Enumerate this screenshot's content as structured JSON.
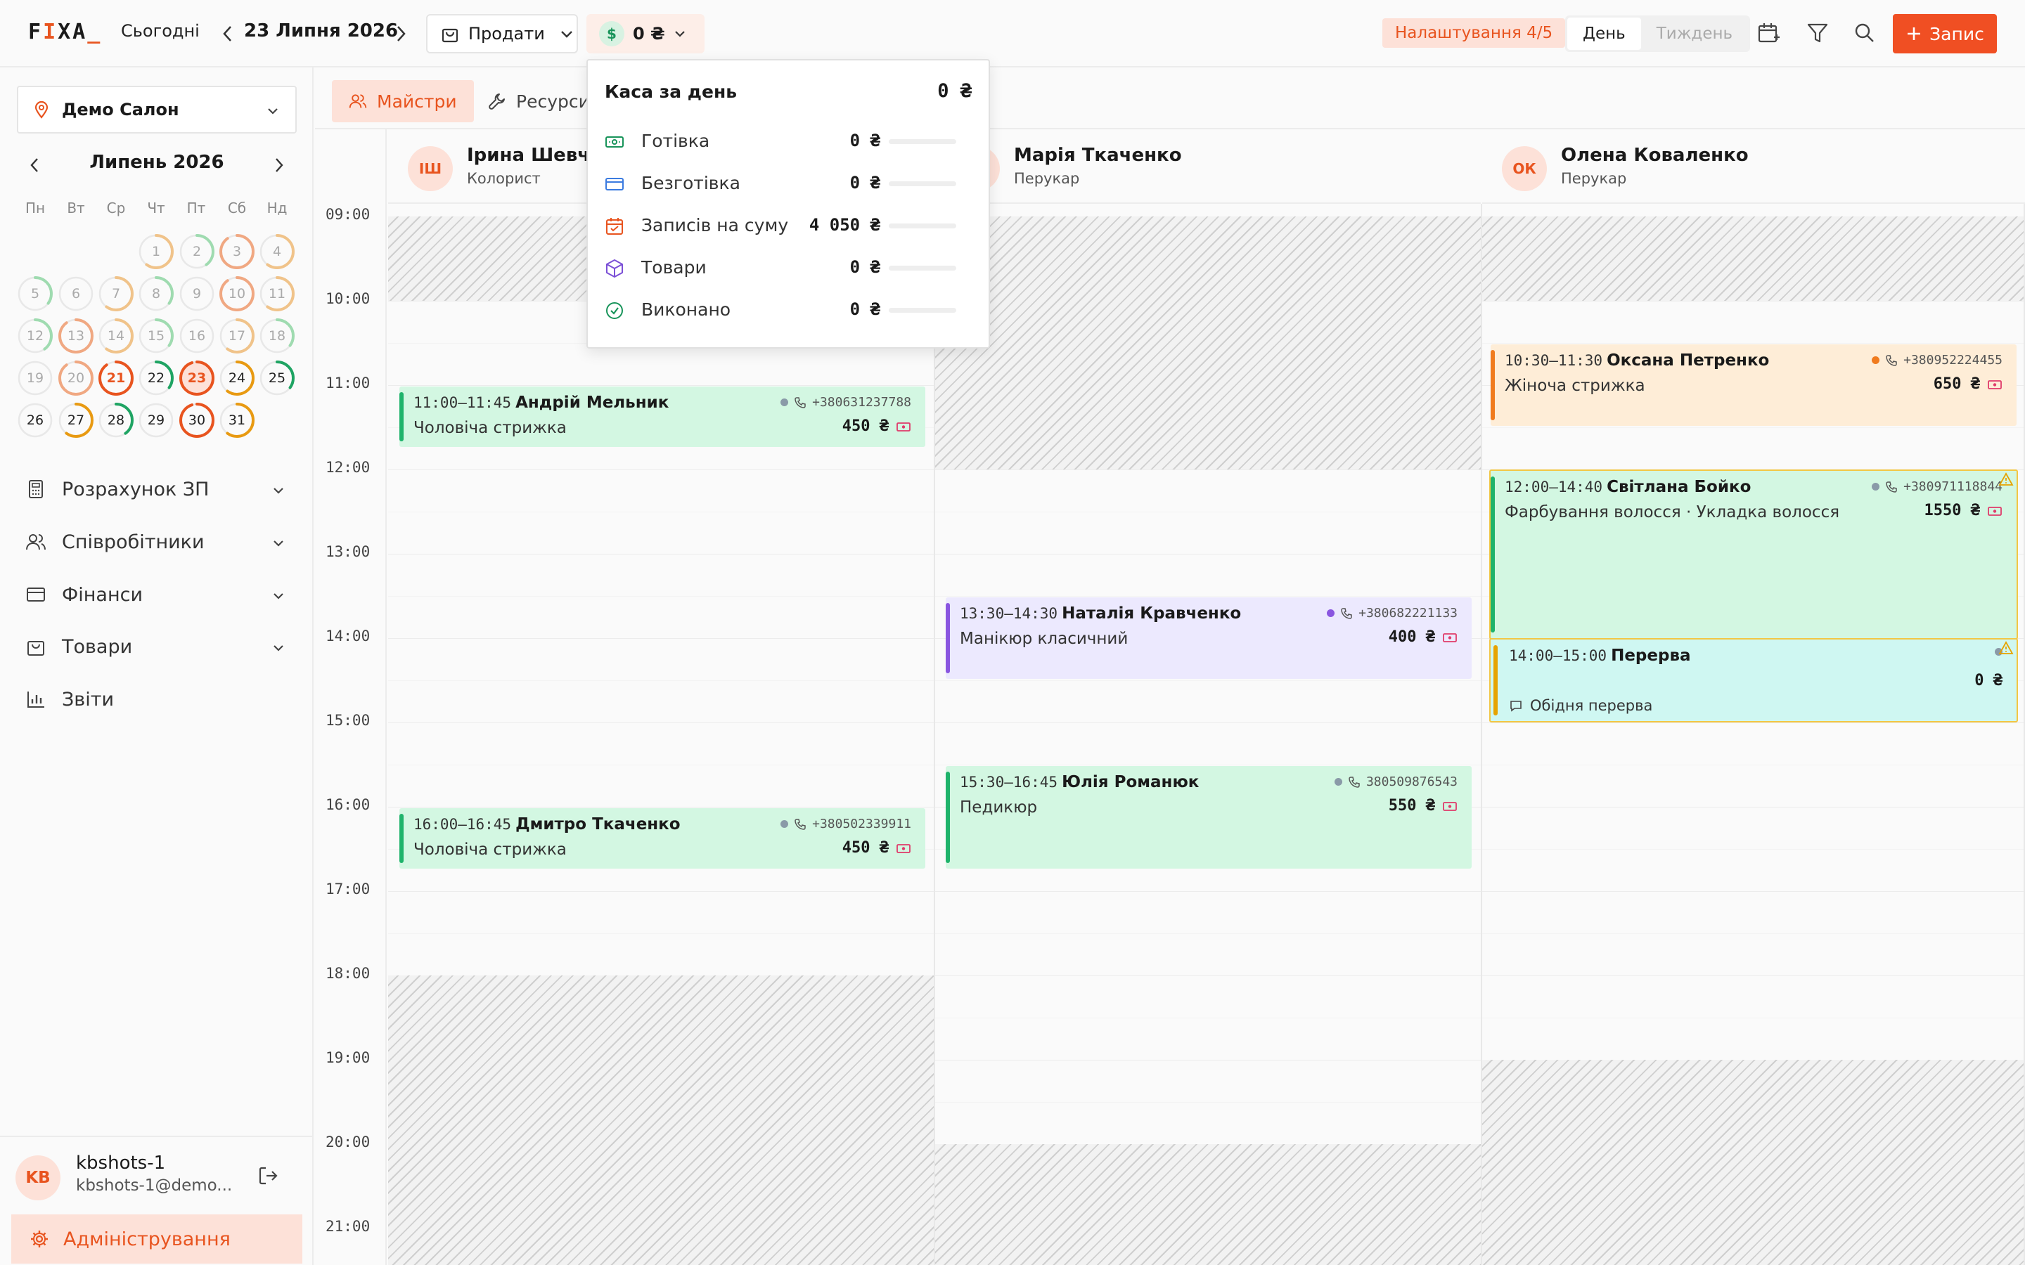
{
  "topbar": {
    "logo": {
      "a": "F",
      "b": "I",
      "c": "XA",
      "d": "_"
    },
    "today": "Сьогодні",
    "date": "23 Липня 2026",
    "sell": "Продати",
    "cash_amount": "0 ₴",
    "cash_symbol": "$",
    "setup": "Налаштування 4/5",
    "view_day": "День",
    "view_week": "Тиждень",
    "add": "Запис",
    "accent": "#f04f23"
  },
  "sidebar": {
    "salon": "Демо Салон",
    "month": "Липень 2026",
    "dow": [
      "Пн",
      "Вт",
      "Ср",
      "Чт",
      "Пт",
      "Сб",
      "Нд"
    ],
    "days": [
      "1",
      "2",
      "3",
      "4",
      "5",
      "6",
      "7",
      "8",
      "9",
      "10",
      "11",
      "12",
      "13",
      "14",
      "15",
      "16",
      "17",
      "18",
      "19",
      "20",
      "21",
      "22",
      "23",
      "24",
      "25",
      "26",
      "27",
      "28",
      "29",
      "30",
      "31"
    ],
    "menu": [
      {
        "label": "Розрахунок ЗП",
        "icon": "calculator-icon"
      },
      {
        "label": "Співробітники",
        "icon": "users-icon"
      },
      {
        "label": "Фінанси",
        "icon": "card-icon"
      },
      {
        "label": "Товари",
        "icon": "bag-icon"
      },
      {
        "label": "Звіти",
        "icon": "chart-icon"
      }
    ],
    "user": {
      "initials": "KB",
      "name": "kbshots-1",
      "email": "kbshots-1@demo..."
    },
    "admin": "Адміністрування"
  },
  "tabs": {
    "masters": "Майстри",
    "resources": "Ресурси"
  },
  "times": [
    "09:00",
    "10:00",
    "11:00",
    "12:00",
    "13:00",
    "14:00",
    "15:00",
    "16:00",
    "17:00",
    "18:00",
    "19:00",
    "20:00",
    "21:00"
  ],
  "staff": [
    {
      "initials": "ІШ",
      "name": "Ірина Шевчук",
      "role": "Колорист"
    },
    {
      "initials": "МТ",
      "name": "Марія Ткаченко",
      "role": "Перукар"
    },
    {
      "initials": "ОК",
      "name": "Олена Коваленко",
      "role": "Перукар"
    }
  ],
  "appointments": [
    {
      "time": "11:00–11:45",
      "client": "Андрій Мельник",
      "phone": "+380631237788",
      "service": "Чоловіча стрижка",
      "price": "450 ₴"
    },
    {
      "time": "16:00–16:45",
      "client": "Дмитро Ткаченко",
      "phone": "+380502339911",
      "service": "Чоловіча стрижка",
      "price": "450 ₴"
    },
    {
      "time": "13:30–14:30",
      "client": "Наталія Кравченко",
      "phone": "+380682221133",
      "service": "Манікюр класичний",
      "price": "400 ₴"
    },
    {
      "time": "15:30–16:45",
      "client": "Юлія Романюк",
      "phone": "380509876543",
      "service": "Педикюр",
      "price": "550 ₴"
    },
    {
      "time": "10:30–11:30",
      "client": "Оксана Петренко",
      "phone": "+380952224455",
      "service": "Жіноча стрижка",
      "price": "650 ₴"
    },
    {
      "time": "12:00–14:40",
      "client": "Світлана Бойко",
      "phone": "+380971118844",
      "service": "Фарбування волосся · Укладка волосся",
      "price": "1550 ₴"
    },
    {
      "time": "14:00–15:00",
      "client": "Перерва",
      "price": "0 ₴",
      "note": "Обідня перерва"
    }
  ],
  "cash_popup": {
    "title": "Каса за день",
    "total": "0 ₴",
    "rows": [
      {
        "label": "Готівка",
        "value": "0 ₴",
        "icon": "cash-icon",
        "color": "#18945a"
      },
      {
        "label": "Безготівка",
        "value": "0 ₴",
        "icon": "card-icon",
        "color": "#3b7be0"
      },
      {
        "label": "Записів на суму",
        "value": "4 050 ₴",
        "icon": "calendar-icon",
        "color": "#e8541f"
      },
      {
        "label": "Товари",
        "value": "0 ₴",
        "icon": "box-icon",
        "color": "#7b4fd6"
      },
      {
        "label": "Виконано",
        "value": "0 ₴",
        "icon": "check-circle-icon",
        "color": "#18945a"
      }
    ]
  }
}
